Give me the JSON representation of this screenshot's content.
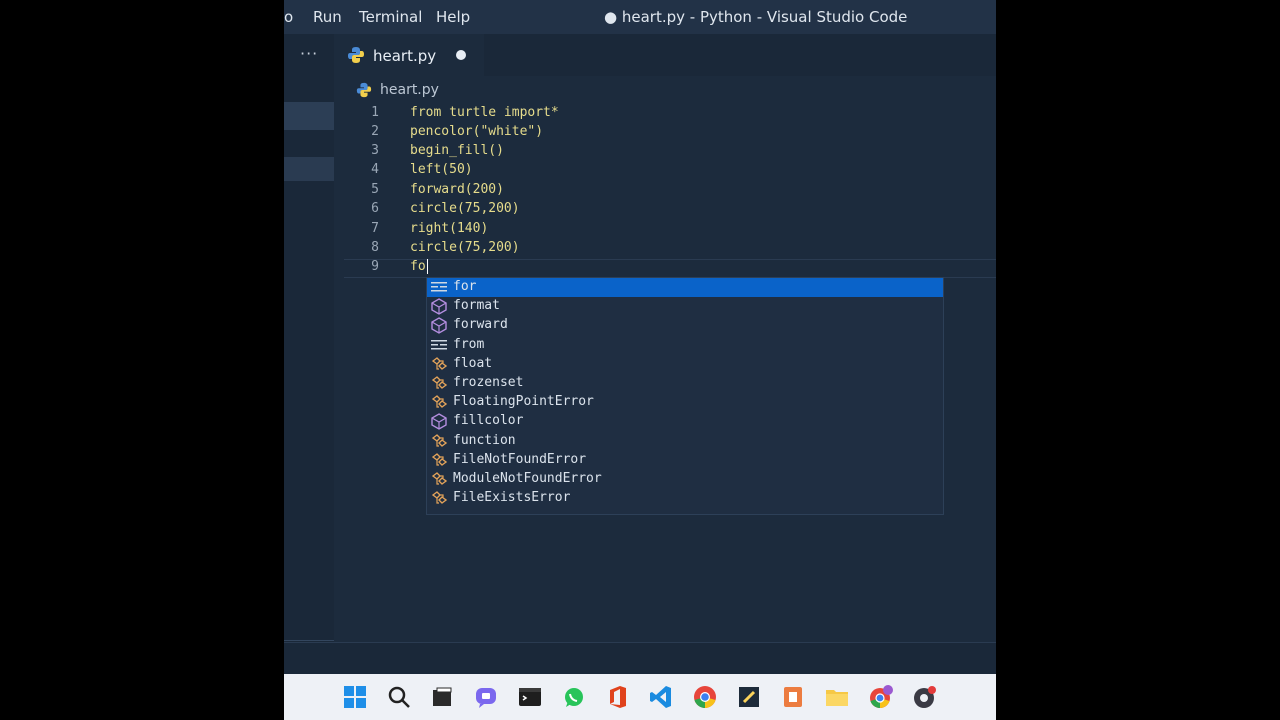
{
  "window": {
    "title": "● heart.py - Python - Visual Studio Code",
    "menu": [
      "o",
      "Run",
      "Terminal",
      "Help"
    ]
  },
  "tabs": [
    {
      "label": "heart.py",
      "dirty": true
    }
  ],
  "overflow_label": "···",
  "breadcrumb": "heart.py",
  "code": [
    {
      "num": "1",
      "text": "from turtle import*"
    },
    {
      "num": "2",
      "text": "pencolor(\"white\")"
    },
    {
      "num": "3",
      "text": "begin_fill()"
    },
    {
      "num": "4",
      "text": "left(50)"
    },
    {
      "num": "5",
      "text": "forward(200)"
    },
    {
      "num": "6",
      "text": "circle(75,200)"
    },
    {
      "num": "7",
      "text": "right(140)"
    },
    {
      "num": "8",
      "text": "circle(75,200)"
    },
    {
      "num": "9",
      "text": "fo"
    }
  ],
  "suggestions": [
    {
      "label": "for",
      "icon": "keyword-icon",
      "selected": true
    },
    {
      "label": "format",
      "icon": "module-icon"
    },
    {
      "label": "forward",
      "icon": "module-icon"
    },
    {
      "label": "from",
      "icon": "keyword-icon"
    },
    {
      "label": "float",
      "icon": "class-icon"
    },
    {
      "label": "frozenset",
      "icon": "class-icon"
    },
    {
      "label": "FloatingPointError",
      "icon": "class-icon"
    },
    {
      "label": "fillcolor",
      "icon": "module-icon"
    },
    {
      "label": "function",
      "icon": "class-icon"
    },
    {
      "label": "FileNotFoundError",
      "icon": "class-icon"
    },
    {
      "label": "ModuleNotFoundError",
      "icon": "class-icon"
    },
    {
      "label": "FileExistsError",
      "icon": "class-icon"
    }
  ],
  "taskbar": [
    "windows-start-icon",
    "search-icon",
    "file-explorer-icon",
    "chat-icon",
    "terminal-icon",
    "whatsapp-icon",
    "office-icon",
    "vscode-icon",
    "chrome-icon",
    "sticky-notes-icon",
    "powerpoint-icon",
    "folder-icon",
    "chrome-profile-icon",
    "obs-icon"
  ],
  "colors": {
    "editor_bg": "#1c2b3d",
    "suggest_selected": "#0a63c9",
    "code_text": "#e6dc8c"
  }
}
